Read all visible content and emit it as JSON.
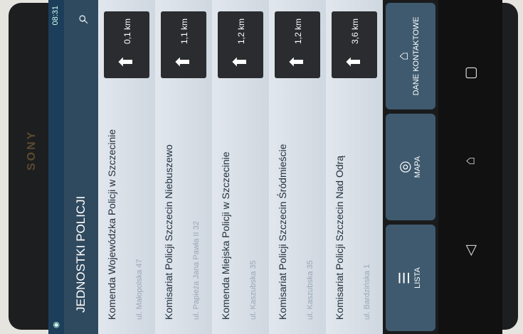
{
  "device": {
    "brand": "SONY"
  },
  "status_bar": {
    "left_text": "◉",
    "right_text": "08:31"
  },
  "title": "JEDNOSTKI POLICJI",
  "search_icon": "search-location-icon",
  "stations": [
    {
      "name": "Komenda Wojewódzka Policji w Szczecinie",
      "address": "ul. Małopolska 47",
      "distance": "0,1 km"
    },
    {
      "name": "Komisariat Policji Szczecin Niebuszewo",
      "address": "ul. Papieża Jana Pawła II 32",
      "distance": "1,1 km"
    },
    {
      "name": "Komenda Miejska Policji w Szczecinie",
      "address": "ul. Kaszubska 35",
      "distance": "1,2 km"
    },
    {
      "name": "Komisariat Policji Szczecin Śródmieście",
      "address": "ul. Kaszubska 35",
      "distance": "1,2 km"
    },
    {
      "name": "Komisariat Policji Szczecin Nad Odrą",
      "address": "ul. Bardzińska 1",
      "distance": "3,6 km"
    }
  ],
  "bottom_tabs": [
    {
      "label": "LISTA",
      "icon": "list-icon"
    },
    {
      "label": "MAPA",
      "icon": "map-icon"
    },
    {
      "label": "DANE KONTAKTOWE",
      "icon": "contact-icon"
    }
  ]
}
